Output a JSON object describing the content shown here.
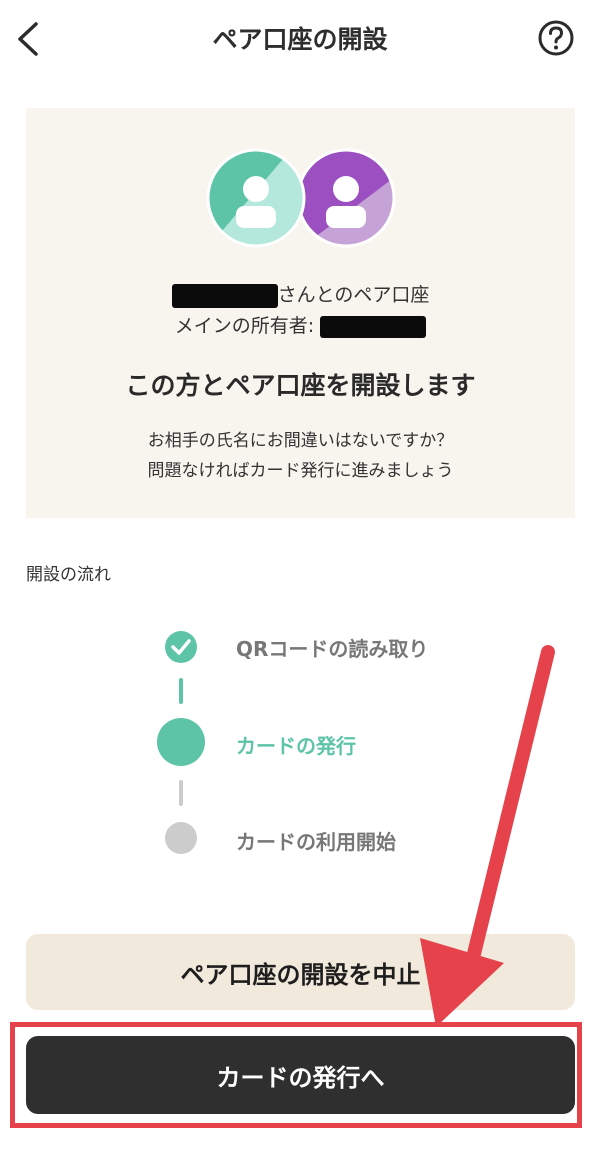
{
  "header": {
    "title": "ペア口座の開設",
    "back_icon": "chevron-left-icon",
    "help_icon": "question-circle-icon"
  },
  "card": {
    "partner_suffix": "さんとのペア口座",
    "owner_prefix": "メインの所有者:",
    "headline": "この方とペア口座を開設します",
    "desc_line1": "お相手の氏名にお間違いはないですか？",
    "desc_line2": "問題なければカード発行に進みましょう"
  },
  "flow": {
    "label": "開設の流れ",
    "steps": [
      {
        "label": "QRコードの読み取り",
        "state": "done"
      },
      {
        "label": "カードの発行",
        "state": "current"
      },
      {
        "label": "カードの利用開始",
        "state": "pending"
      }
    ]
  },
  "buttons": {
    "cancel_label": "ペア口座の開設を中止",
    "issue_label": "カードの発行へ"
  },
  "colors": {
    "accent_green": "#5dc4a7",
    "accent_purple": "#9b4fc0",
    "annotation_red": "#e5424b",
    "primary_button": "#2f2f2f",
    "secondary_button": "#f0e9dc",
    "card_background": "#f8f5ef"
  }
}
